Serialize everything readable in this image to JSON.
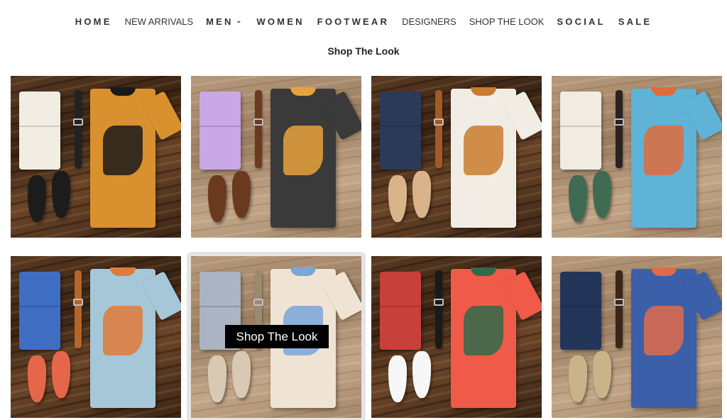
{
  "nav": {
    "items": [
      {
        "label": "HOME",
        "style": "spaced"
      },
      {
        "label": "NEW ARRIVALS",
        "style": "compact"
      },
      {
        "label": "MEN",
        "style": "spaced",
        "dropdown": true
      },
      {
        "label": "WOMEN",
        "style": "spaced"
      },
      {
        "label": "FOOTWEAR",
        "style": "spaced"
      },
      {
        "label": "DESIGNERS",
        "style": "compact"
      },
      {
        "label": "SHOP THE LOOK",
        "style": "compact"
      },
      {
        "label": "SOCIAL",
        "style": "spaced"
      },
      {
        "label": "SALE",
        "style": "spaced"
      }
    ],
    "dropdown_icon": "chevron-down-icon"
  },
  "page": {
    "title": "Shop The Look"
  },
  "grid": {
    "hover_cta_label": "Shop The Look",
    "looks": [
      {
        "name": "look-1",
        "background": "dark",
        "pants": "#f2ede3",
        "shirt": "#d9902f",
        "shirt_accent": "#1a1a1a",
        "belt": "#222222",
        "shoes": "#1c1c1c"
      },
      {
        "name": "look-2",
        "background": "light",
        "pants": "#c9a8e6",
        "shirt": "#3a3a3a",
        "shirt_accent": "#e8a23c",
        "belt": "#6a3a1f",
        "shoes": "#6b3a1e"
      },
      {
        "name": "look-3",
        "background": "dark",
        "pants": "#2c3a5a",
        "shirt": "#f1ede4",
        "shirt_accent": "#c97b2e",
        "belt": "#a35a26",
        "shoes": "#d9b48a"
      },
      {
        "name": "look-4",
        "background": "light",
        "pants": "#f0ece2",
        "shirt": "#5fb3d6",
        "shirt_accent": "#e06b3c",
        "belt": "#2a2220",
        "shoes": "#3f6b52"
      },
      {
        "name": "look-5",
        "background": "dark",
        "pants": "#3f6dc2",
        "shirt": "#a6c7d8",
        "shirt_accent": "#e07a3a",
        "belt": "#b5652a",
        "shoes": "#e6664a"
      },
      {
        "name": "look-6",
        "background": "light",
        "pants": "#aab4c2",
        "shirt": "#efe4d4",
        "shirt_accent": "#7aa6d9",
        "belt": "#9a8a70",
        "shoes": "#d8cab2",
        "hovered": true
      },
      {
        "name": "look-7",
        "background": "dark",
        "pants": "#c8403a",
        "shirt": "#f05a48",
        "shirt_accent": "#2f6a4a",
        "belt": "#1a1a1a",
        "shoes": "#f7f7f7"
      },
      {
        "name": "look-8",
        "background": "light",
        "pants": "#24355a",
        "shirt": "#3b5fa8",
        "shirt_accent": "#e06a4a",
        "belt": "#3b2418",
        "shoes": "#c9b48a"
      }
    ]
  }
}
